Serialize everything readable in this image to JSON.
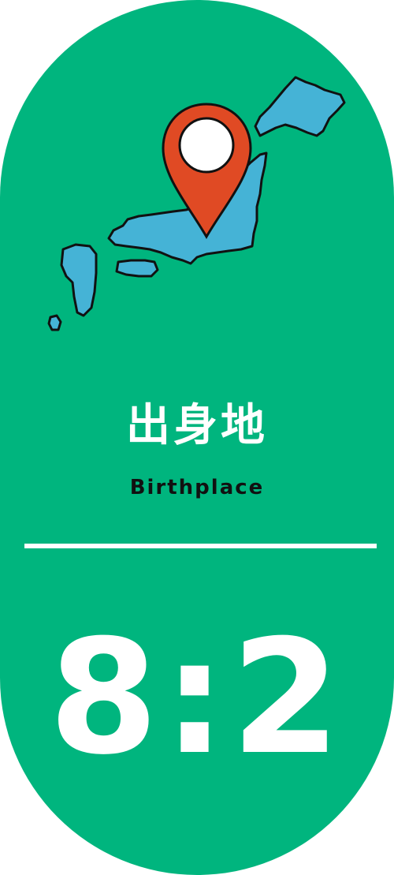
{
  "card": {
    "title": "出身地",
    "subtitle": "Birthplace",
    "ratio": "8:2"
  },
  "icons": {
    "map": "japan-map-icon",
    "pin": "location-pin-icon"
  },
  "colors": {
    "background": "#00b57e",
    "map_fill": "#45b3d6",
    "pin_fill": "#e04a24",
    "text_light": "#ffffff",
    "text_dark": "#111111"
  }
}
